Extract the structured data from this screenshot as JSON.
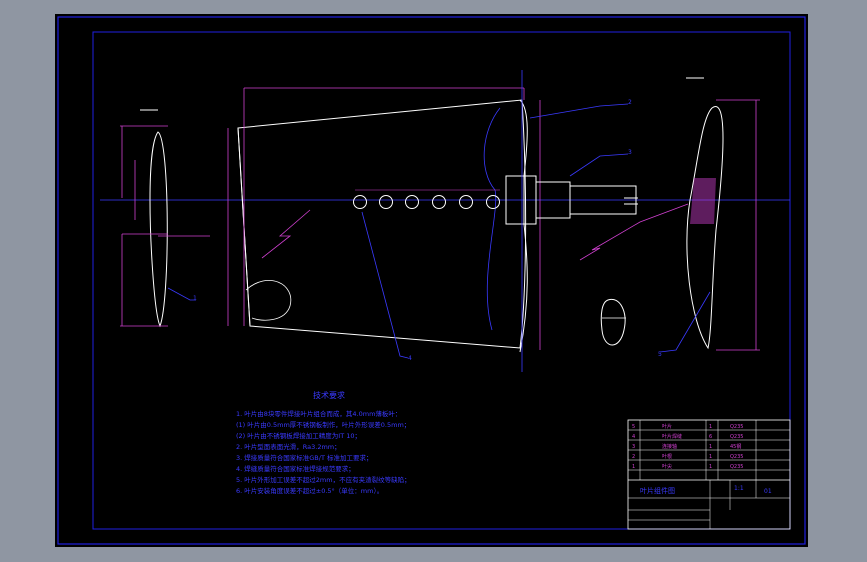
{
  "colors": {
    "background": "#8f96a2",
    "paper": "#000000",
    "frame": "#2020e0",
    "part": "#ffffff",
    "dimension": "#d040d0",
    "leader": "#3a3aff",
    "hatch": "#d040d0"
  },
  "notes": {
    "title": "技术要求",
    "lines": [
      "1. 叶片由8块零件焊接叶片组合而成，其4.0mm薄板叶：",
      "  (1) 叶片由0.5mm厚不锈钢板制作，叶片外形误差0.5mm；",
      "  (2) 叶片由不锈钢板焊接加工精度为IT 10；",
      "2. 叶片型面表面光滑，Ra3.2mm；",
      "3. 焊接质量符合国家标准GB/T 标准加工要求；",
      "4. 焊缝质量符合国家标准焊接规范要求；",
      "5. 叶片外形加工误差不超过2mm，不应有夹渣裂纹等缺陷；",
      "6. 叶片安装角度误差不超过±0.5°（单位：mm）。"
    ]
  },
  "title_block": {
    "drawing_name": "叶片组件图",
    "scale": "1:1",
    "sheet": "01",
    "rows": [
      [
        "5",
        "叶片",
        "1",
        "Q235",
        ""
      ],
      [
        "4",
        "叶片焊缝",
        "6",
        "Q235",
        ""
      ],
      [
        "3",
        "连接轴",
        "1",
        "45钢",
        ""
      ],
      [
        "2",
        "叶根",
        "1",
        "Q235",
        ""
      ],
      [
        "1",
        "叶尖",
        "1",
        "Q235",
        ""
      ]
    ]
  },
  "callouts": [
    "1",
    "2",
    "3",
    "4",
    "5",
    "6"
  ]
}
